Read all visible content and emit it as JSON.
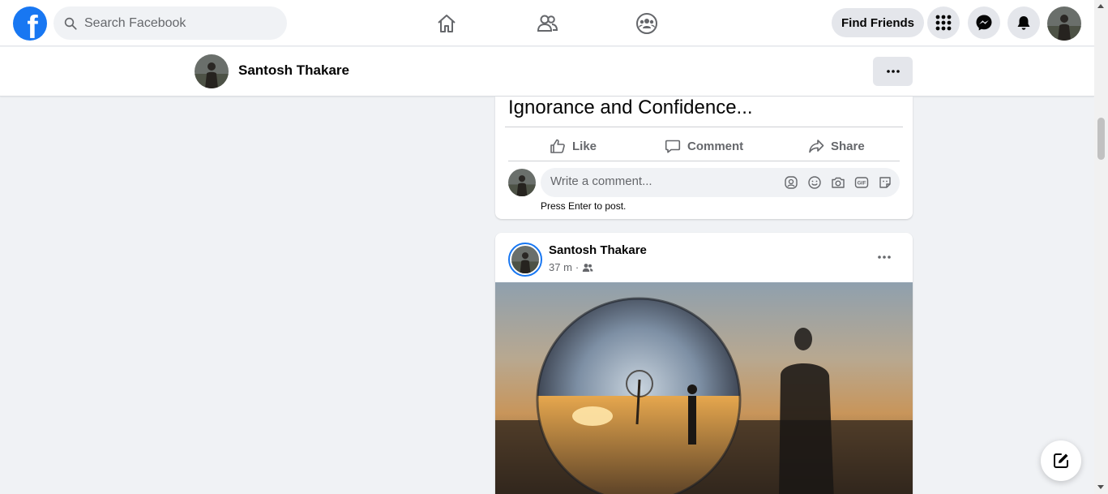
{
  "header": {
    "search_placeholder": "Search Facebook",
    "find_friends_label": "Find Friends",
    "icons": [
      "home-icon",
      "friends-icon",
      "groups-icon",
      "menu-grid-icon",
      "messenger-icon",
      "notifications-icon"
    ]
  },
  "profile_bar": {
    "name": "Santosh Thakare"
  },
  "post1": {
    "text": "Ignorance and Confidence...",
    "like_label": "Like",
    "comment_label": "Comment",
    "share_label": "Share",
    "comment_placeholder": "Write a comment...",
    "press_enter_hint": "Press Enter to post."
  },
  "post2": {
    "author": "Santosh Thakare",
    "time": "37 m",
    "separator": "·",
    "audience_icon": "friends-audience-icon"
  },
  "colors": {
    "brand_blue": "#1877f2",
    "background": "#f0f2f5",
    "secondary_text": "#65676b"
  }
}
